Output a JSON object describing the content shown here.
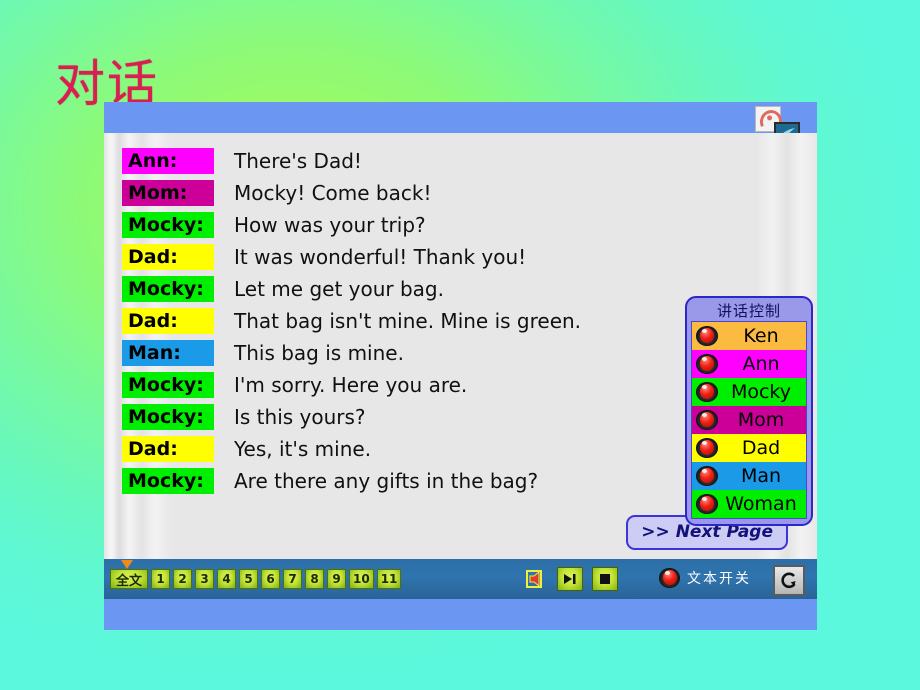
{
  "slide": {
    "title": "对话",
    "title_color": "#d82050",
    "background_colors": [
      "#9dfb63",
      "#5cf8dd"
    ]
  },
  "window": {
    "titlebar": {
      "icons": [
        {
          "name": "swirl-icon",
          "label": "swirl-icon"
        },
        {
          "name": "bird-icon",
          "label": "bird-icon"
        }
      ]
    }
  },
  "dialogue": {
    "lines": [
      {
        "speaker": "Ann:",
        "text": "There's Dad!",
        "color": "#ff00ff"
      },
      {
        "speaker": "Mom:",
        "text": "Mocky! Come back!",
        "color": "#cc0099"
      },
      {
        "speaker": "Mocky:",
        "text": "How was your trip?",
        "color": "#00ee00"
      },
      {
        "speaker": "Dad:",
        "text": "It was wonderful! Thank you!",
        "color": "#ffff00"
      },
      {
        "speaker": "Mocky:",
        "text": "Let me get your bag.",
        "color": "#00ee00"
      },
      {
        "speaker": "Dad:",
        "text": "That bag isn't mine. Mine is green.",
        "color": "#ffff00"
      },
      {
        "speaker": "Man:",
        "text": "This bag is mine.",
        "color": "#1b9ae8"
      },
      {
        "speaker": "Mocky:",
        "text": "I'm sorry. Here you are.",
        "color": "#00ee00"
      },
      {
        "speaker": "Mocky:",
        "text": "Is this yours?",
        "color": "#00ee00"
      },
      {
        "speaker": "Dad:",
        "text": "Yes, it's mine.",
        "color": "#ffff00"
      },
      {
        "speaker": "Mocky:",
        "text": "Are there any gifts in the bag?",
        "color": "#00ee00"
      }
    ],
    "next_page_label": ">> Next Page"
  },
  "speaker_panel": {
    "title": "讲话控制",
    "buttons": [
      {
        "label": "Ken",
        "color": "#fbbb41"
      },
      {
        "label": "Ann",
        "color": "#ff00ff"
      },
      {
        "label": "Mocky",
        "color": "#00ee00"
      },
      {
        "label": "Mom",
        "color": "#cc0099"
      },
      {
        "label": "Dad",
        "color": "#ffff00"
      },
      {
        "label": "Man",
        "color": "#1b9ae8"
      },
      {
        "label": "Woman",
        "color": "#00ee00"
      }
    ]
  },
  "toolbar": {
    "page_buttons": [
      "全文",
      "1",
      "2",
      "3",
      "4",
      "5",
      "6",
      "7",
      "8",
      "9",
      "10",
      "11"
    ],
    "media": {
      "speaker_icon": "speaker-icon",
      "play_icon": "play-next-icon",
      "stop_icon": "stop-icon"
    },
    "text_toggle_label": "文本开关",
    "refresh_icon": "refresh-icon"
  }
}
